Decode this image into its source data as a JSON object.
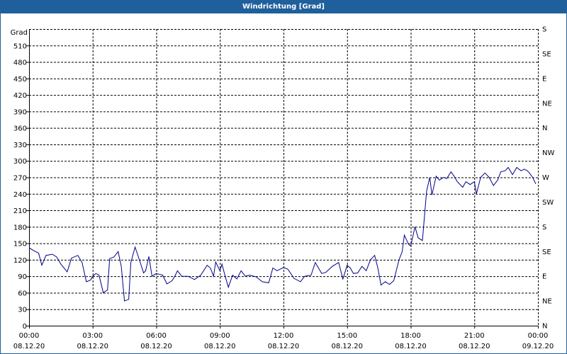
{
  "window": {
    "title": "Windrichtung [Grad]"
  },
  "colors": {
    "titlebar": "#1e5f9c",
    "line": "#00008b",
    "grid": "#000000",
    "background": "#ffffff"
  },
  "chart_data": {
    "type": "line",
    "title": "Windrichtung [Grad]",
    "ylabel": "Grad",
    "xlabel": "",
    "ylim": [
      0,
      540
    ],
    "yticks": [
      0,
      30,
      60,
      90,
      120,
      150,
      180,
      210,
      240,
      270,
      300,
      330,
      360,
      390,
      420,
      450,
      480,
      510
    ],
    "xlim_hours": [
      0,
      24
    ],
    "xticks": [
      {
        "h": 0,
        "time": "00:00",
        "date": "08.12.20"
      },
      {
        "h": 3,
        "time": "03:00",
        "date": "08.12.20"
      },
      {
        "h": 6,
        "time": "06:00",
        "date": "08.12.20"
      },
      {
        "h": 9,
        "time": "09:00",
        "date": "08.12.20"
      },
      {
        "h": 12,
        "time": "12:00",
        "date": "08.12.20"
      },
      {
        "h": 15,
        "time": "15:00",
        "date": "08.12.20"
      },
      {
        "h": 18,
        "time": "18:00",
        "date": "08.12.20"
      },
      {
        "h": 21,
        "time": "21:00",
        "date": "08.12.20"
      },
      {
        "h": 24,
        "time": "00:00",
        "date": "09.12.20"
      }
    ],
    "right_axis": [
      {
        "v": 0,
        "label": "N"
      },
      {
        "v": 45,
        "label": "NE"
      },
      {
        "v": 90,
        "label": "E"
      },
      {
        "v": 135,
        "label": "SE"
      },
      {
        "v": 180,
        "label": "S"
      },
      {
        "v": 225,
        "label": "SW"
      },
      {
        "v": 270,
        "label": "W"
      },
      {
        "v": 315,
        "label": "NW"
      },
      {
        "v": 360,
        "label": "N"
      },
      {
        "v": 405,
        "label": "NE"
      },
      {
        "v": 450,
        "label": "E"
      },
      {
        "v": 495,
        "label": "SE"
      },
      {
        "v": 540,
        "label": "S"
      }
    ],
    "grid": true,
    "series": [
      {
        "hours": [
          0.0,
          0.2,
          0.45,
          0.6,
          0.8,
          1.1,
          1.3,
          1.5,
          1.8,
          2.0,
          2.3,
          2.5,
          2.7,
          2.9,
          3.0,
          3.15,
          3.3,
          3.5,
          3.7,
          3.8,
          4.0,
          4.2,
          4.35,
          4.5,
          4.7,
          4.8,
          5.0,
          5.2,
          5.4,
          5.5,
          5.65,
          5.8,
          6.0,
          6.2,
          6.3,
          6.5,
          6.75,
          6.9,
          7.0,
          7.2,
          7.5,
          7.8,
          8.1,
          8.4,
          8.55,
          8.7,
          8.8,
          9.0,
          9.1,
          9.25,
          9.4,
          9.6,
          9.8,
          10.0,
          10.2,
          10.4,
          10.7,
          11.0,
          11.3,
          11.5,
          11.7,
          12.0,
          12.2,
          12.5,
          12.8,
          13.0,
          13.3,
          13.5,
          13.8,
          14.0,
          14.3,
          14.6,
          14.8,
          15.0,
          15.15,
          15.3,
          15.5,
          15.7,
          15.9,
          16.1,
          16.3,
          16.45,
          16.6,
          16.8,
          17.0,
          17.2,
          17.45,
          17.6,
          17.7,
          17.9,
          18.0,
          18.2,
          18.35,
          18.55,
          18.75,
          18.9,
          19.0,
          19.2,
          19.35,
          19.55,
          19.7,
          19.9,
          20.05,
          20.2,
          20.45,
          20.6,
          20.8,
          21.0,
          21.1,
          21.3,
          21.5,
          21.7,
          21.9,
          22.1,
          22.25,
          22.45,
          22.6,
          22.8,
          23.0,
          23.2,
          23.35,
          23.5,
          23.6,
          23.75,
          23.9
        ],
        "values": [
          142,
          137,
          132,
          110,
          128,
          130,
          125,
          112,
          98,
          123,
          128,
          115,
          80,
          83,
          90,
          95,
          92,
          60,
          65,
          122,
          125,
          135,
          108,
          45,
          48,
          115,
          143,
          120,
          96,
          100,
          126,
          90,
          95,
          93,
          92,
          76,
          82,
          92,
          100,
          90,
          90,
          84,
          92,
          110,
          105,
          90,
          116,
          100,
          112,
          90,
          70,
          92,
          85,
          100,
          90,
          92,
          89,
          80,
          78,
          105,
          100,
          106,
          103,
          86,
          80,
          90,
          92,
          115,
          95,
          97,
          108,
          115,
          85,
          110,
          105,
          95,
          96,
          108,
          100,
          120,
          128,
          105,
          74,
          80,
          75,
          82,
          120,
          135,
          165,
          148,
          145,
          180,
          160,
          155,
          245,
          270,
          238,
          272,
          265,
          270,
          268,
          280,
          272,
          262,
          252,
          262,
          257,
          262,
          240,
          270,
          278,
          270,
          255,
          265,
          280,
          282,
          288,
          275,
          288,
          282,
          285,
          282,
          278,
          270,
          258,
          268
        ]
      }
    ]
  }
}
